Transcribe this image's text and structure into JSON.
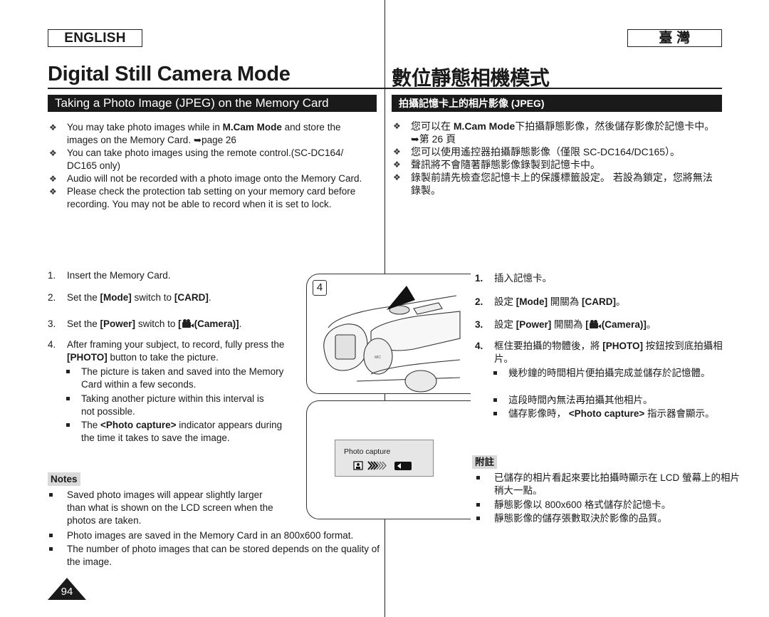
{
  "header": {
    "lang_left": "ENGLISH",
    "lang_right": "臺 灣",
    "title_en": "Digital Still Camera Mode",
    "title_zh": "數位靜態相機模式"
  },
  "section": {
    "title_en": "Taking a Photo Image (JPEG) on the Memory Card",
    "title_zh": "拍攝記憶卡上的相片影像 (JPEG)"
  },
  "intro_en": {
    "b1_pre": "You may take photo images while in ",
    "b1_bold": "M.Cam Mode",
    "b1_post": " and store the images on the Memory Card. ➥page 26",
    "b2": "You can take photo images using the remote control.(SC-DC164/ DC165 only)",
    "b3": "Audio will not be recorded with a photo image onto the Memory Card.",
    "b4": "Please check the protection tab setting on your memory card before recording. You may not be able to record when it is set to lock."
  },
  "intro_zh": {
    "b1_pre": "您可以在 ",
    "b1_bold": "M.Cam Mode",
    "b1_post": "下拍攝靜態影像，然後儲存影像於記憶卡中。➥第 26 頁",
    "b2": "您可以使用遙控器拍攝靜態影像（僅限 SC-DC164/DC165）。",
    "b3": "聲訊將不會隨著靜態影像錄製到記憶卡中。",
    "b4": "錄製前請先檢查您記憶卡上的保護標籤設定。 若設為鎖定，您將無法錄製。"
  },
  "steps_en": {
    "s1_num": "1.",
    "s1": "Insert the Memory Card.",
    "s2_num": "2.",
    "s2_a": "Set the ",
    "s2_b": "[Mode]",
    "s2_c": " switch to ",
    "s2_d": "[CARD]",
    "s2_e": ".",
    "s3_num": "3.",
    "s3_a": "Set the ",
    "s3_b": "[Power]",
    "s3_c": " switch to ",
    "s3_d": "[",
    "s3_e": "(Camera)]",
    "s3_f": ".",
    "s4_num": "4.",
    "s4_a": "After framing your subject, to record, fully press the ",
    "s4_b": "[PHOTO]",
    "s4_c": " button to take the picture.",
    "sub1": "The picture is taken and saved into the Memory Card within a few seconds.",
    "sub2": "Taking another picture within this interval is not possible.",
    "sub3_a": "The ",
    "sub3_b": "<Photo capture>",
    "sub3_c": " indicator appears during the time it takes to save the image."
  },
  "steps_zh": {
    "s1_num": "1.",
    "s1": "插入記憶卡。",
    "s2_num": "2.",
    "s2_a": "設定 ",
    "s2_b": "[Mode]",
    "s2_c": " 開關為 ",
    "s2_d": "[CARD]",
    "s2_e": "。",
    "s3_num": "3.",
    "s3_a": "設定 ",
    "s3_b": "[Power]",
    "s3_c": " 開關為 ",
    "s3_d": "[",
    "s3_e": "(Camera)]",
    "s3_f": "。",
    "s4_num": "4.",
    "s4_a": "框住要拍攝的物體後，將 ",
    "s4_b": "[PHOTO]",
    "s4_c": " 按鈕按到底拍攝相片。",
    "sub1": "幾秒鐘的時間相片便拍攝完成並儲存於記憶體。",
    "sub2": "這段時間內無法再拍攝其他相片。",
    "sub3_a": "儲存影像時， ",
    "sub3_b": "<Photo capture>",
    "sub3_c": " 指示器會顯示。"
  },
  "notes_en": {
    "label": "Notes",
    "n1": "Saved photo images will appear slightly larger than what is shown on the LCD screen when the photos are taken.",
    "n2": "Photo images are saved in the Memory Card in an 800x600 format.",
    "n3": "The number of photo images that can be stored depends on the quality of the image."
  },
  "notes_zh": {
    "label": "附註",
    "n1": "已儲存的相片看起來要比拍攝時顯示在 LCD 螢幕上的相片稍大一點。",
    "n2": "靜態影像以 800x600 格式儲存於記憶卡。",
    "n3": "靜態影像的儲存張數取決於影像的品質。"
  },
  "figure": {
    "step_number": "4",
    "mic_label": "MIC",
    "lcd_label": "Photo capture"
  },
  "page": {
    "number": "94"
  }
}
